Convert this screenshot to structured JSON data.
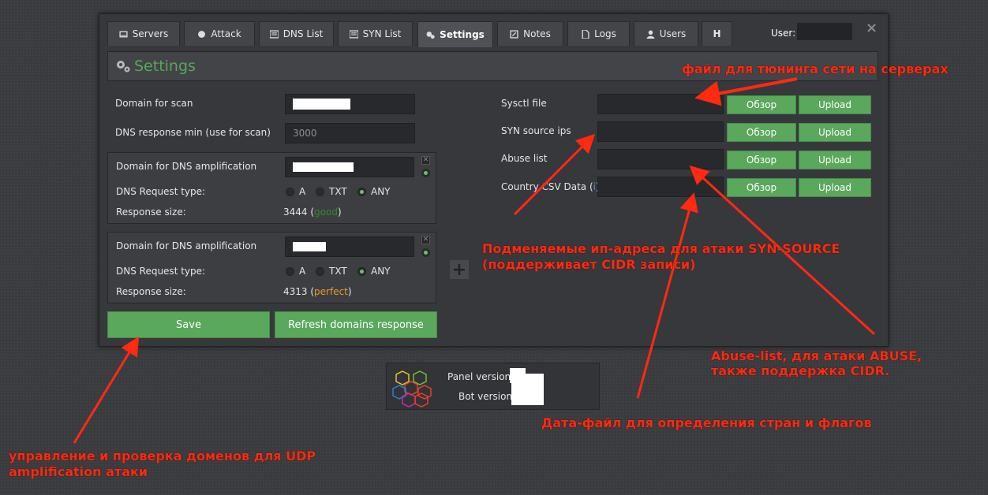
{
  "tabs": [
    {
      "label": "Servers",
      "icon": "server-icon"
    },
    {
      "label": "Attack",
      "icon": "attack-icon"
    },
    {
      "label": "DNS List",
      "icon": "list-icon"
    },
    {
      "label": "SYN List",
      "icon": "list-icon"
    },
    {
      "label": "Settings",
      "icon": "gears-icon",
      "active": true
    },
    {
      "label": "Notes",
      "icon": "edit-icon"
    },
    {
      "label": "Logs",
      "icon": "file-icon"
    },
    {
      "label": "Users",
      "icon": "user-icon"
    },
    {
      "label": "H",
      "icon": ""
    }
  ],
  "user_label": "User:",
  "close_icon": "×",
  "settings_title": "Settings",
  "left": {
    "domain_scan_label": "Domain for scan",
    "dns_min_label": "DNS response min (use for scan)",
    "dns_min_placeholder": "3000",
    "groups": [
      {
        "domain_label": "Domain for DNS amplification",
        "req_type_label": "DNS Request type:",
        "options": [
          "A",
          "TXT",
          "ANY"
        ],
        "selected": "ANY",
        "resp_label": "Response size:",
        "resp_value": "3444",
        "resp_quality": "good",
        "resp_quality_color": "#2e8b2e"
      },
      {
        "domain_label": "Domain for DNS amplification",
        "req_type_label": "DNS Request type:",
        "options": [
          "A",
          "TXT",
          "ANY"
        ],
        "selected": "ANY",
        "resp_label": "Response size:",
        "resp_value": "4313",
        "resp_quality": "perfect",
        "resp_quality_color": "#e89b1a"
      }
    ],
    "save_label": "Save",
    "refresh_label": "Refresh domains response"
  },
  "right": {
    "rows": [
      {
        "label": "Sysctl file",
        "browse": "Обзор",
        "upload": "Upload"
      },
      {
        "label": "SYN source ips",
        "browse": "Обзор",
        "upload": "Upload"
      },
      {
        "label": "Abuse list",
        "browse": "Обзор",
        "upload": "Upload"
      },
      {
        "label": "Country CSV Data",
        "browse": "Обзор",
        "upload": "Upload"
      }
    ],
    "info_icon": "i"
  },
  "versions": {
    "panel_label": "Panel version:",
    "bot_label": "Bot version:"
  },
  "annotations": {
    "a1": "файл для тюнинга сети на серверах",
    "a2_line1": "Подменяемые ип-адреса для атаки SYN-SOURCE",
    "a2_line2": "(поддерживает CIDR записи)",
    "a3_line1": "Abuse-list, для атаки ABUSE,",
    "a3_line2": "также поддержка CIDR.",
    "a4": "Дата-файл для определения стран и флагов",
    "a5_line1": "управление и проверка доменов для UDP",
    "a5_line2": "amplification атаки"
  },
  "colors": {
    "accent_green": "#5aa85c",
    "annotation_red": "#ff2a10"
  }
}
